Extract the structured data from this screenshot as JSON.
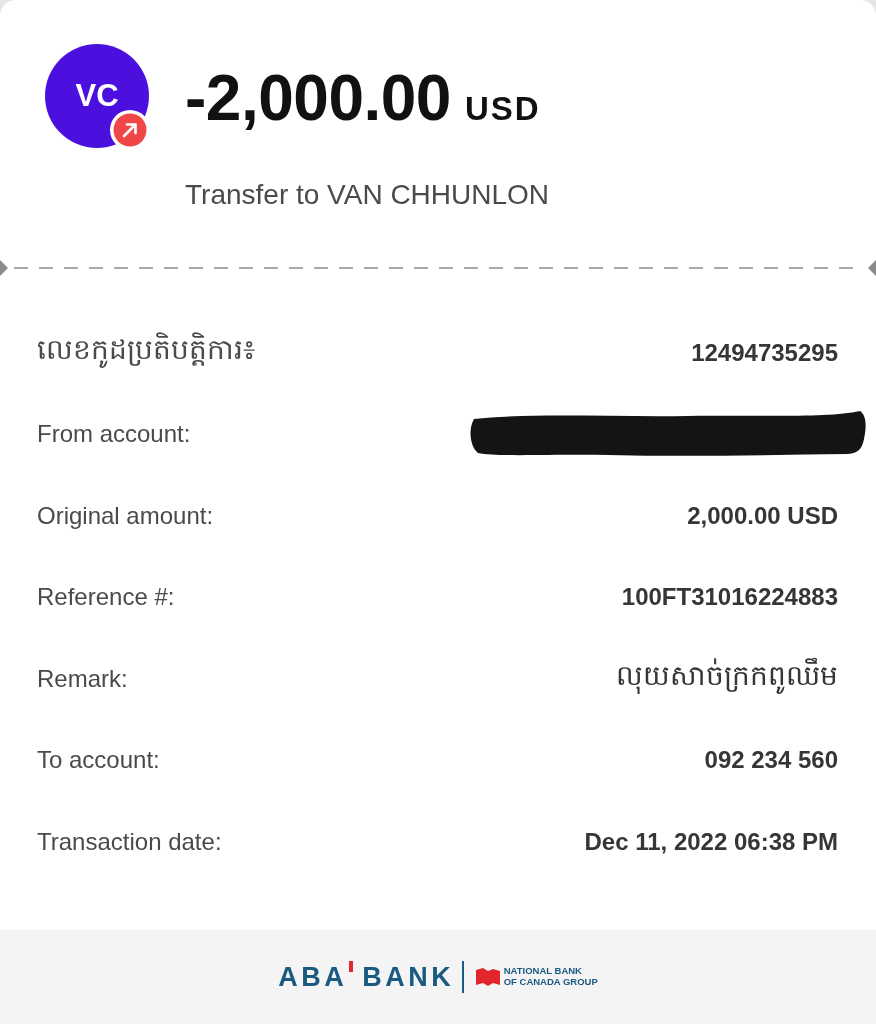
{
  "header": {
    "initials": "VC",
    "amount": "-2,000.00",
    "currency": "USD",
    "description": "Transfer to VAN CHHUNLON"
  },
  "details": [
    {
      "kind": "code",
      "label": "លេខកូដប្រតិបត្តិការ៖",
      "value": "12494735295"
    },
    {
      "kind": "redacted",
      "label": "From account:"
    },
    {
      "kind": "text",
      "label": "Original amount:",
      "value": "2,000.00 USD"
    },
    {
      "kind": "text",
      "label": "Reference #:",
      "value": "100FT31016224883"
    },
    {
      "kind": "remark",
      "label": "Remark:",
      "value": "លុយសាច់ក្រកពូឈឹម"
    },
    {
      "kind": "text",
      "label": "To account:",
      "value": "092 234 560"
    },
    {
      "kind": "text",
      "label": "Transaction date:",
      "value": "Dec 11, 2022 06:38 PM"
    }
  ],
  "footer": {
    "brand_words": [
      "ABA",
      "BANK"
    ],
    "partner_lines": [
      "NATIONAL BANK",
      "OF CANADA GROUP"
    ]
  }
}
